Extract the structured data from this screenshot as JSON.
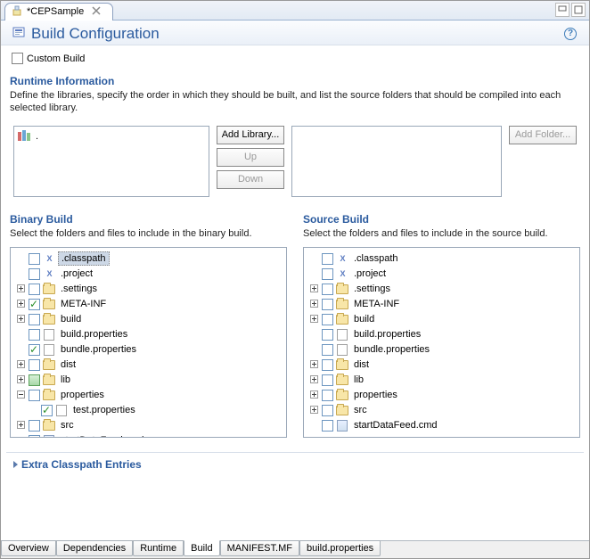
{
  "tab": {
    "title": "*CEPSample"
  },
  "page": {
    "title": "Build Configuration"
  },
  "custom_build": {
    "label": "Custom Build",
    "checked": false
  },
  "runtime": {
    "title": "Runtime Information",
    "desc": "Define the libraries, specify the order in which they should be built, and list the source folders that should be compiled into each selected library.",
    "lib_root": ".",
    "buttons": {
      "add_library": "Add Library...",
      "up": "Up",
      "down": "Down",
      "add_folder": "Add Folder..."
    }
  },
  "binary": {
    "title": "Binary Build",
    "desc": "Select the folders and files to include in the binary build.",
    "items": [
      {
        "name": ".classpath",
        "sel": true,
        "chk": false,
        "exp": "",
        "icon": "xml"
      },
      {
        "name": ".project",
        "chk": false,
        "exp": "",
        "icon": "xml"
      },
      {
        "name": ".settings",
        "chk": false,
        "exp": "+",
        "icon": "folder"
      },
      {
        "name": "META-INF",
        "chk": true,
        "exp": "+",
        "icon": "folder"
      },
      {
        "name": "build",
        "chk": false,
        "exp": "+",
        "icon": "folder"
      },
      {
        "name": "build.properties",
        "chk": false,
        "exp": "",
        "icon": "file"
      },
      {
        "name": "bundle.properties",
        "chk": true,
        "exp": "",
        "icon": "file"
      },
      {
        "name": "dist",
        "chk": false,
        "exp": "+",
        "icon": "folder"
      },
      {
        "name": "lib",
        "chk": "fill",
        "exp": "+",
        "icon": "folder"
      },
      {
        "name": "properties",
        "chk": false,
        "exp": "-",
        "icon": "folder"
      },
      {
        "name": "test.properties",
        "chk": true,
        "exp": "",
        "icon": "file",
        "indent": 1
      },
      {
        "name": "src",
        "chk": false,
        "exp": "+",
        "icon": "folder"
      },
      {
        "name": "startDataFeed.cmd",
        "chk": false,
        "exp": "",
        "icon": "cmd"
      }
    ]
  },
  "source": {
    "title": "Source Build",
    "desc": "Select the folders and files to include in the source build.",
    "items": [
      {
        "name": ".classpath",
        "chk": false,
        "exp": "",
        "icon": "xml"
      },
      {
        "name": ".project",
        "chk": false,
        "exp": "",
        "icon": "xml"
      },
      {
        "name": ".settings",
        "chk": false,
        "exp": "+",
        "icon": "folder"
      },
      {
        "name": "META-INF",
        "chk": false,
        "exp": "+",
        "icon": "folder"
      },
      {
        "name": "build",
        "chk": false,
        "exp": "+",
        "icon": "folder"
      },
      {
        "name": "build.properties",
        "chk": false,
        "exp": "",
        "icon": "file"
      },
      {
        "name": "bundle.properties",
        "chk": false,
        "exp": "",
        "icon": "file"
      },
      {
        "name": "dist",
        "chk": false,
        "exp": "+",
        "icon": "folder"
      },
      {
        "name": "lib",
        "chk": false,
        "exp": "+",
        "icon": "folder"
      },
      {
        "name": "properties",
        "chk": false,
        "exp": "+",
        "icon": "folder"
      },
      {
        "name": "src",
        "chk": false,
        "exp": "+",
        "icon": "folder"
      },
      {
        "name": "startDataFeed.cmd",
        "chk": false,
        "exp": "",
        "icon": "cmd"
      }
    ]
  },
  "extra": {
    "title": "Extra Classpath Entries"
  },
  "bottom_tabs": [
    "Overview",
    "Dependencies",
    "Runtime",
    "Build",
    "MANIFEST.MF",
    "build.properties"
  ],
  "active_bottom_tab": "Build"
}
